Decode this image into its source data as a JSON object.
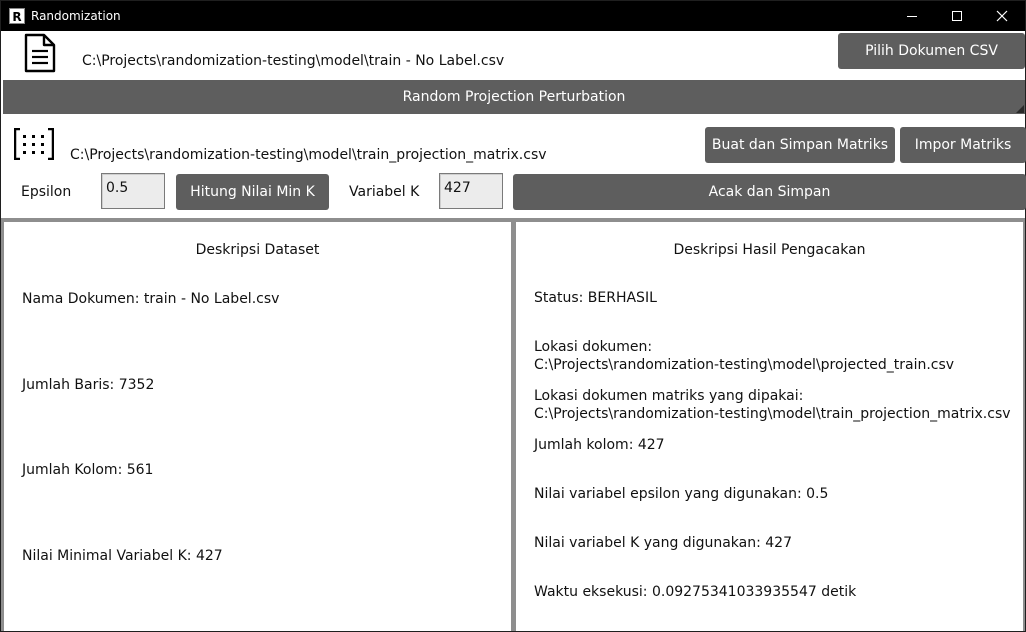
{
  "window": {
    "title": "Randomization",
    "app_icon_letter": "R"
  },
  "csv": {
    "path": "C:\\Projects\\randomization-testing\\model\\train - No Label.csv",
    "choose_button": "Pilih Dokumen CSV"
  },
  "section": {
    "title": "Random Projection Perturbation"
  },
  "matrix": {
    "path": "C:\\Projects\\randomization-testing\\model\\train_projection_matrix.csv",
    "create_button": "Buat dan Simpan Matriks",
    "import_button": "Impor Matriks"
  },
  "params": {
    "epsilon_label": "Epsilon",
    "epsilon_value": "0.5",
    "compute_button": "Hitung Nilai Min K",
    "k_label": "Variabel K",
    "k_value": "427",
    "randomize_button": "Acak dan Simpan"
  },
  "dataset": {
    "title": "Deskripsi Dataset",
    "name": "Nama Dokumen: train - No Label.csv",
    "rows": "Jumlah Baris: 7352",
    "cols": "Jumlah Kolom: 561",
    "min_k": "Nilai Minimal Variabel K: 427"
  },
  "result": {
    "title": "Deskripsi Hasil Pengacakan",
    "status": "Status: BERHASIL",
    "location_label": "Lokasi dokumen:",
    "location_value": "C:\\Projects\\randomization-testing\\model\\projected_train.csv",
    "matrix_label": "Lokasi dokumen matriks yang dipakai:",
    "matrix_value": "C:\\Projects\\randomization-testing\\model\\train_projection_matrix.csv",
    "columns": "Jumlah kolom: 427",
    "epsilon_used": "Nilai variabel epsilon yang digunakan: 0.5",
    "k_used": "Nilai variabel K yang digunakan: 427",
    "exec_time": "Waktu eksekusi: 0.09275341033935547 detik"
  }
}
